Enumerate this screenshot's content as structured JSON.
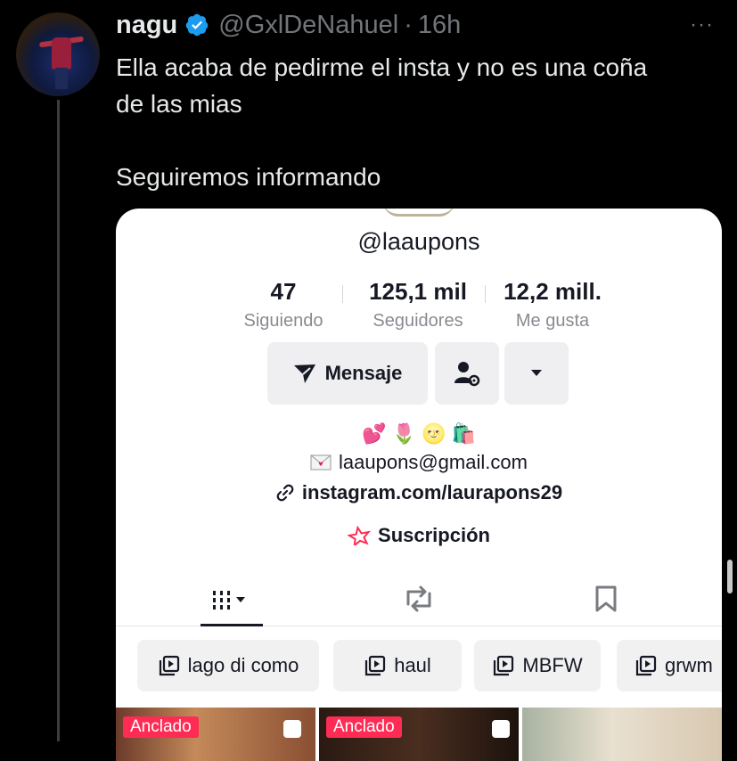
{
  "tweet": {
    "display_name": "nagu",
    "handle": "@GxlDeNahuel",
    "separator": "·",
    "time": "16h",
    "more": "···",
    "text": "Ella acaba de pedirme el insta y no es una coña\nde las mias\n\nSeguiremos informando",
    "verified_color": "#1d9bf0"
  },
  "tiktok": {
    "username": "@laaupons",
    "stats": [
      {
        "value": "47",
        "label": "Siguiendo"
      },
      {
        "value": "125,1 mil",
        "label": "Seguidores"
      },
      {
        "value": "12,2 mill.",
        "label": "Me gusta"
      }
    ],
    "message_button": "Mensaje",
    "emojis": [
      "💕",
      "🌷",
      "🌝",
      "🛍️"
    ],
    "email": "laaupons@gmail.com",
    "link": "instagram.com/laurapons29",
    "subscription": "Suscripción",
    "playlists": [
      "lago di como",
      "haul",
      "MBFW",
      "grwm"
    ],
    "pinned_label": "Anclado",
    "accent": "#fe2c55"
  }
}
